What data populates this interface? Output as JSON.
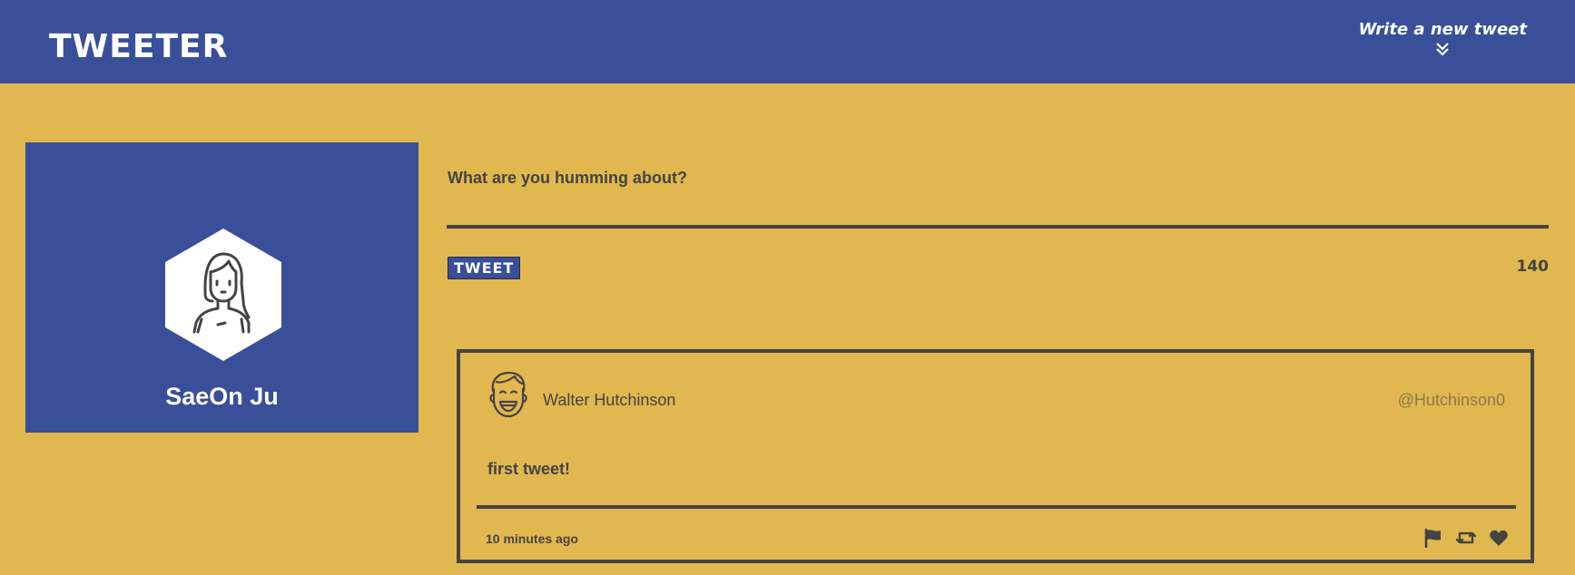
{
  "nav": {
    "brand": "TWEETER",
    "compose_toggle_label": "Write a new tweet",
    "compose_toggle_icon": "double-chevron-down-icon"
  },
  "profile": {
    "name": "SaeOn Ju",
    "avatar_icon": "person-avatar-icon"
  },
  "composer": {
    "label": "What are you humming about?",
    "input_value": "",
    "submit_label": "TWEET",
    "char_counter": "140"
  },
  "tweets": [
    {
      "author_name": "Walter Hutchinson",
      "handle": "@Hutchinson0",
      "avatar_icon": "smiling-person-avatar-icon",
      "content": "first tweet!",
      "timestamp": "10 minutes ago",
      "actions": [
        "flag-icon",
        "retweet-icon",
        "heart-icon"
      ]
    }
  ],
  "colors": {
    "background": "#e1b74f",
    "nav_bg": "#394f99",
    "text": "#444444",
    "handle_text": "#8c7a4f"
  }
}
